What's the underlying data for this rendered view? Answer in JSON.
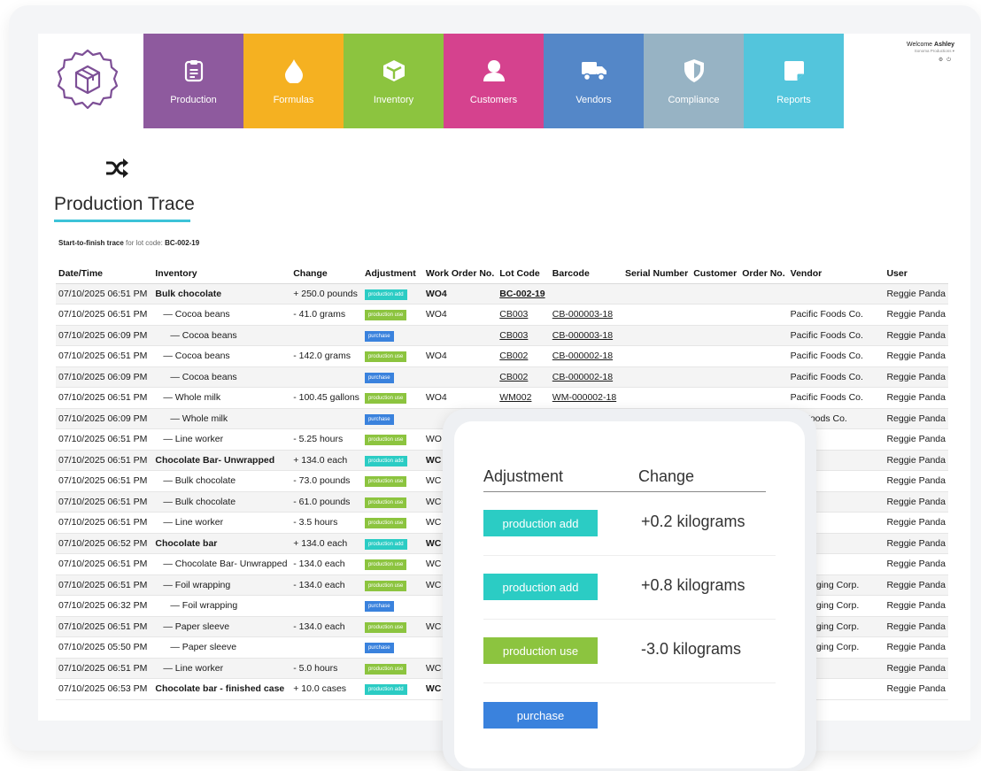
{
  "header": {
    "nav": [
      {
        "label": "Production",
        "icon": "clipboard-icon"
      },
      {
        "label": "Formulas",
        "icon": "drop-icon"
      },
      {
        "label": "Inventory",
        "icon": "box-icon"
      },
      {
        "label": "Customers",
        "icon": "person-icon"
      },
      {
        "label": "Vendors",
        "icon": "truck-icon"
      },
      {
        "label": "Compliance",
        "icon": "shield-icon"
      },
      {
        "label": "Reports",
        "icon": "note-icon"
      }
    ],
    "welcome_prefix": "Welcome",
    "user_name": "Ashley",
    "company": "Sonoma Productions ▾"
  },
  "page": {
    "title": "Production Trace",
    "trace_prefix": "Start-to-finish trace",
    "trace_mid": "for lot code:",
    "lot_code": "BC-002-19"
  },
  "table": {
    "columns": [
      "Date/Time",
      "Inventory",
      "Change",
      "Adjustment",
      "Work Order No.",
      "Lot Code",
      "Barcode",
      "Serial Number",
      "Customer",
      "Order No.",
      "Vendor",
      "User"
    ],
    "rows": [
      {
        "dt": "07/10/2025 06:51 PM",
        "inv": "Bulk chocolate",
        "chg": "+ 250.0 pounds",
        "adj": "production add",
        "wo": "WO4",
        "lot": "BC-002-19",
        "bar": "",
        "vendor": "",
        "user": "Reggie Panda"
      },
      {
        "dt": "07/10/2025 06:51 PM",
        "inv": "— Cocoa beans",
        "chg": "- 41.0 grams",
        "adj": "production use",
        "wo": "WO4",
        "lot": "CB003",
        "bar": "CB-000003-18",
        "vendor": "Pacific Foods Co.",
        "user": "Reggie Panda"
      },
      {
        "dt": "07/10/2025 06:09 PM",
        "inv": "— Cocoa beans",
        "chg": "",
        "adj": "purchase",
        "wo": "",
        "lot": "CB003",
        "bar": "CB-000003-18",
        "vendor": "Pacific Foods Co.",
        "user": "Reggie Panda"
      },
      {
        "dt": "07/10/2025 06:51 PM",
        "inv": "— Cocoa beans",
        "chg": "- 142.0 grams",
        "adj": "production use",
        "wo": "WO4",
        "lot": "CB002",
        "bar": "CB-000002-18",
        "vendor": "Pacific Foods Co.",
        "user": "Reggie Panda"
      },
      {
        "dt": "07/10/2025 06:09 PM",
        "inv": "— Cocoa beans",
        "chg": "",
        "adj": "purchase",
        "wo": "",
        "lot": "CB002",
        "bar": "CB-000002-18",
        "vendor": "Pacific Foods Co.",
        "user": "Reggie Panda"
      },
      {
        "dt": "07/10/2025 06:51 PM",
        "inv": "— Whole milk",
        "chg": "- 100.45 gallons",
        "adj": "production use",
        "wo": "WO4",
        "lot": "WM002",
        "bar": "WM-000002-18",
        "vendor": "Pacific Foods Co.",
        "user": "Reggie Panda"
      },
      {
        "dt": "07/10/2025 06:09 PM",
        "inv": "— Whole milk",
        "chg": "",
        "adj": "purchase",
        "wo": "",
        "lot": "",
        "bar": "",
        "vendor": "ific Foods Co.",
        "user": "Reggie Panda"
      },
      {
        "dt": "07/10/2025 06:51 PM",
        "inv": "— Line worker",
        "chg": "- 5.25 hours",
        "adj": "production use",
        "wo": "WO",
        "lot": "",
        "bar": "",
        "vendor": "",
        "user": "Reggie Panda"
      },
      {
        "dt": "07/10/2025 06:51 PM",
        "inv": "Chocolate Bar- Unwrapped",
        "chg": "+ 134.0 each",
        "adj": "production add",
        "wo": "WC",
        "lot": "",
        "bar": "",
        "vendor": "",
        "user": "Reggie Panda"
      },
      {
        "dt": "07/10/2025 06:51 PM",
        "inv": "— Bulk chocolate",
        "chg": "- 73.0 pounds",
        "adj": "production use",
        "wo": "WC",
        "lot": "",
        "bar": "",
        "vendor": "",
        "user": "Reggie Panda"
      },
      {
        "dt": "07/10/2025 06:51 PM",
        "inv": "— Bulk chocolate",
        "chg": "- 61.0 pounds",
        "adj": "production use",
        "wo": "WC",
        "lot": "",
        "bar": "",
        "vendor": "",
        "user": "Reggie Panda"
      },
      {
        "dt": "07/10/2025 06:51 PM",
        "inv": "— Line worker",
        "chg": "- 3.5 hours",
        "adj": "production use",
        "wo": "WC",
        "lot": "",
        "bar": "",
        "vendor": "",
        "user": "Reggie Panda"
      },
      {
        "dt": "07/10/2025 06:52 PM",
        "inv": "Chocolate bar",
        "chg": "+ 134.0 each",
        "adj": "production add",
        "wo": "WC",
        "lot": "",
        "bar": "",
        "vendor": "",
        "user": "Reggie Panda"
      },
      {
        "dt": "07/10/2025 06:51 PM",
        "inv": "— Chocolate Bar- Unwrapped",
        "chg": "- 134.0 each",
        "adj": "production use",
        "wo": "WC",
        "lot": "",
        "bar": "",
        "vendor": "",
        "user": "Reggie Panda"
      },
      {
        "dt": "07/10/2025 06:51 PM",
        "inv": "— Foil wrapping",
        "chg": "- 134.0 each",
        "adj": "production use",
        "wo": "WC",
        "lot": "",
        "bar": "",
        "vendor": "Packaging Corp.",
        "user": "Reggie Panda"
      },
      {
        "dt": "07/10/2025 06:32 PM",
        "inv": "— Foil wrapping",
        "chg": "",
        "adj": "purchase",
        "wo": "",
        "lot": "",
        "bar": "",
        "vendor": "Packaging Corp.",
        "user": "Reggie Panda"
      },
      {
        "dt": "07/10/2025 06:51 PM",
        "inv": "— Paper sleeve",
        "chg": "- 134.0 each",
        "adj": "production use",
        "wo": "WC",
        "lot": "",
        "bar": "",
        "vendor": "Packaging Corp.",
        "user": "Reggie Panda"
      },
      {
        "dt": "07/10/2025 05:50 PM",
        "inv": "— Paper sleeve",
        "chg": "",
        "adj": "purchase",
        "wo": "",
        "lot": "",
        "bar": "",
        "vendor": "Packaging Corp.",
        "user": "Reggie Panda"
      },
      {
        "dt": "07/10/2025 06:51 PM",
        "inv": "— Line worker",
        "chg": "- 5.0 hours",
        "adj": "production use",
        "wo": "WC",
        "lot": "",
        "bar": "",
        "vendor": "",
        "user": "Reggie Panda"
      },
      {
        "dt": "07/10/2025 06:53 PM",
        "inv": "Chocolate bar - finished case",
        "chg": "+ 10.0 cases",
        "adj": "production add",
        "wo": "WC",
        "lot": "",
        "bar": "",
        "vendor": "",
        "user": "Reggie Panda"
      }
    ]
  },
  "popup": {
    "head_adjustment": "Adjustment",
    "head_change": "Change",
    "rows": [
      {
        "badge": "production add",
        "change": "+0.2 kilograms"
      },
      {
        "badge": "production add",
        "change": "+0.8 kilograms"
      },
      {
        "badge": "production use",
        "change": "-3.0 kilograms"
      },
      {
        "badge": "purchase",
        "change": ""
      }
    ]
  },
  "colors": {
    "production_add": "#2bccc4",
    "production_use": "#8cc43f",
    "purchase": "#3a82dd",
    "accent_underline": "#3cc3d8"
  }
}
